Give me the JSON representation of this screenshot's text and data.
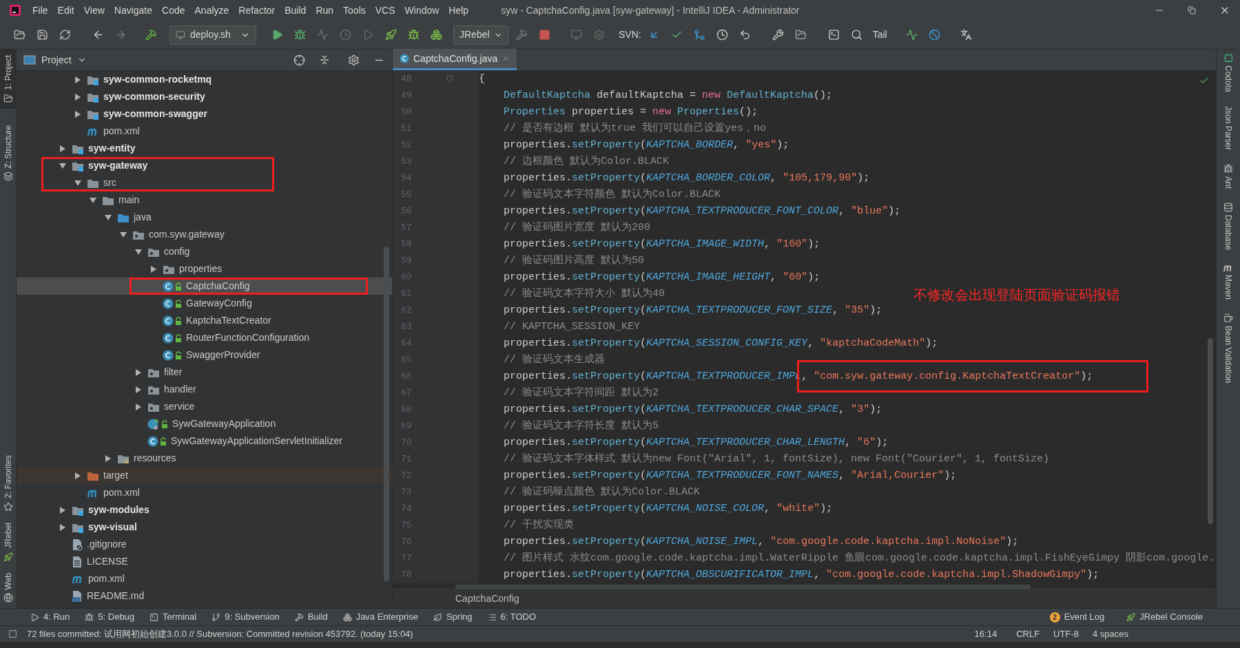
{
  "window": {
    "title": "syw - CaptchaConfig.java [syw-gateway] - IntelliJ IDEA - Administrator"
  },
  "menus": [
    "File",
    "Edit",
    "View",
    "Navigate",
    "Code",
    "Analyze",
    "Refactor",
    "Build",
    "Run",
    "Tools",
    "VCS",
    "Window",
    "Help"
  ],
  "toolbar": {
    "run_config": "deploy.sh",
    "jrebel": "JRebel",
    "svn_label": "SVN:",
    "tail": "Tail"
  },
  "left_tool_windows": [
    {
      "label": "1: Project",
      "kind": "project",
      "selected": true
    },
    {
      "label": "Z: Structure",
      "kind": "structure",
      "selected": false
    },
    {
      "label": "2: Favorites",
      "kind": "favorites",
      "selected": false
    },
    {
      "label": "JRebel",
      "kind": "jrebel",
      "selected": false
    },
    {
      "label": "Web",
      "kind": "web",
      "selected": false
    }
  ],
  "project": {
    "title": "Project",
    "tree": [
      {
        "children": [
          {
            "label": "syw-common-rocketmq",
            "kind": "module",
            "expanded": false,
            "selected": false
          },
          {
            "label": "syw-common-security",
            "kind": "module",
            "expanded": false,
            "selected": false
          },
          {
            "label": "syw-common-swagger",
            "kind": "module",
            "expanded": false,
            "selected": false
          },
          {
            "label": "pom.xml",
            "kind": "maven",
            "selected": false
          }
        ]
      },
      {
        "label": "syw-entity",
        "kind": "module",
        "expanded": false,
        "selected": false
      },
      {
        "label": "syw-gateway",
        "kind": "module",
        "expanded": true,
        "selected": false,
        "children": [
          {
            "label": "src",
            "kind": "folder",
            "expanded": true,
            "selected": false,
            "children": [
              {
                "label": "main",
                "kind": "folder",
                "expanded": true,
                "selected": false,
                "children": [
                  {
                    "label": "java",
                    "kind": "source-folder",
                    "expanded": true,
                    "selected": false,
                    "children": [
                      {
                        "label": "com.syw.gateway",
                        "kind": "package",
                        "expanded": true,
                        "selected": false,
                        "children": [
                          {
                            "label": "config",
                            "kind": "package",
                            "expanded": true,
                            "selected": false,
                            "children": [
                              {
                                "label": "properties",
                                "kind": "package",
                                "expanded": false,
                                "selected": false
                              },
                              {
                                "label": "CaptchaConfig",
                                "kind": "class",
                                "selected": true
                              },
                              {
                                "label": "GatewayConfig",
                                "kind": "class",
                                "selected": false
                              },
                              {
                                "label": "KaptchaTextCreator",
                                "kind": "class",
                                "selected": false
                              },
                              {
                                "label": "RouterFunctionConfiguration",
                                "kind": "class",
                                "selected": false
                              },
                              {
                                "label": "SwaggerProvider",
                                "kind": "class",
                                "selected": false
                              }
                            ]
                          },
                          {
                            "label": "filter",
                            "kind": "package",
                            "expanded": false,
                            "selected": false
                          },
                          {
                            "label": "handler",
                            "kind": "package",
                            "expanded": false,
                            "selected": false
                          },
                          {
                            "label": "service",
                            "kind": "package",
                            "expanded": false,
                            "selected": false
                          },
                          {
                            "label": "SywGatewayApplication",
                            "kind": "app-class",
                            "selected": false
                          },
                          {
                            "label": "SywGatewayApplicationServletInitializer",
                            "kind": "class",
                            "selected": false
                          }
                        ]
                      }
                    ]
                  },
                  {
                    "label": "resources",
                    "kind": "resources",
                    "expanded": false,
                    "selected": false
                  }
                ]
              }
            ]
          },
          {
            "label": "target",
            "kind": "excluded",
            "expanded": false,
            "selected": false
          },
          {
            "label": "pom.xml",
            "kind": "maven",
            "selected": false
          }
        ]
      },
      {
        "label": "syw-modules",
        "kind": "module",
        "expanded": false,
        "selected": false
      },
      {
        "label": "syw-visual",
        "kind": "module",
        "expanded": false,
        "selected": false
      },
      {
        "label": ".gitignore",
        "kind": "ignore-file",
        "selected": false
      },
      {
        "label": "LICENSE",
        "kind": "text-file",
        "selected": false
      },
      {
        "label": "pom.xml",
        "kind": "maven",
        "selected": false
      },
      {
        "label": "README.md",
        "kind": "markdown",
        "selected": false
      }
    ]
  },
  "editor": {
    "tab": {
      "label": "CaptchaConfig.java",
      "selected": true
    },
    "lines": [
      {
        "num": "48",
        "fold": true,
        "tokens": [
          {
            "kind": "plain",
            "text": "{"
          }
        ]
      },
      {
        "num": "49",
        "tokens": [
          {
            "kind": "type",
            "text": "    DefaultKaptcha"
          },
          {
            "kind": "plain",
            "text": " defaultKaptcha = "
          },
          {
            "kind": "keyword",
            "text": "new "
          },
          {
            "kind": "type",
            "text": "DefaultKaptcha"
          },
          {
            "kind": "plain",
            "text": "();"
          }
        ]
      },
      {
        "num": "50",
        "tokens": [
          {
            "kind": "type",
            "text": "    Properties"
          },
          {
            "kind": "plain",
            "text": " properties = "
          },
          {
            "kind": "keyword",
            "text": "new "
          },
          {
            "kind": "type",
            "text": "Properties"
          },
          {
            "kind": "plain",
            "text": "();"
          }
        ]
      },
      {
        "num": "51",
        "tokens": [
          {
            "kind": "comment",
            "text": "    // 是否有边框 默认为true 我们可以自己设置yes，no"
          }
        ]
      },
      {
        "num": "52",
        "tokens": [
          {
            "kind": "plain",
            "text": "    properties."
          },
          {
            "kind": "method",
            "text": "setProperty"
          },
          {
            "kind": "plain",
            "text": "("
          },
          {
            "kind": "constant",
            "text": "KAPTCHA_BORDER"
          },
          {
            "kind": "plain",
            "text": ", "
          },
          {
            "kind": "string",
            "text": "\"yes\""
          },
          {
            "kind": "plain",
            "text": ");"
          }
        ]
      },
      {
        "num": "53",
        "tokens": [
          {
            "kind": "comment",
            "text": "    // 边框颜色 默认为Color.BLACK"
          }
        ]
      },
      {
        "num": "54",
        "tokens": [
          {
            "kind": "plain",
            "text": "    properties."
          },
          {
            "kind": "method",
            "text": "setProperty"
          },
          {
            "kind": "plain",
            "text": "("
          },
          {
            "kind": "constant",
            "text": "KAPTCHA_BORDER_COLOR"
          },
          {
            "kind": "plain",
            "text": ", "
          },
          {
            "kind": "string",
            "text": "\"105,179,90\""
          },
          {
            "kind": "plain",
            "text": ");"
          }
        ]
      },
      {
        "num": "55",
        "tokens": [
          {
            "kind": "comment",
            "text": "    // 验证码文本字符颜色 默认为Color.BLACK"
          }
        ]
      },
      {
        "num": "56",
        "tokens": [
          {
            "kind": "plain",
            "text": "    properties."
          },
          {
            "kind": "method",
            "text": "setProperty"
          },
          {
            "kind": "plain",
            "text": "("
          },
          {
            "kind": "constant",
            "text": "KAPTCHA_TEXTPRODUCER_FONT_COLOR"
          },
          {
            "kind": "plain",
            "text": ", "
          },
          {
            "kind": "string",
            "text": "\"blue\""
          },
          {
            "kind": "plain",
            "text": ");"
          }
        ]
      },
      {
        "num": "57",
        "tokens": [
          {
            "kind": "comment",
            "text": "    // 验证码图片宽度 默认为200"
          }
        ]
      },
      {
        "num": "58",
        "tokens": [
          {
            "kind": "plain",
            "text": "    properties."
          },
          {
            "kind": "method",
            "text": "setProperty"
          },
          {
            "kind": "plain",
            "text": "("
          },
          {
            "kind": "constant",
            "text": "KAPTCHA_IMAGE_WIDTH"
          },
          {
            "kind": "plain",
            "text": ", "
          },
          {
            "kind": "string",
            "text": "\"160\""
          },
          {
            "kind": "plain",
            "text": ");"
          }
        ]
      },
      {
        "num": "59",
        "tokens": [
          {
            "kind": "comment",
            "text": "    // 验证码图片高度 默认为50"
          }
        ]
      },
      {
        "num": "60",
        "tokens": [
          {
            "kind": "plain",
            "text": "    properties."
          },
          {
            "kind": "method",
            "text": "setProperty"
          },
          {
            "kind": "plain",
            "text": "("
          },
          {
            "kind": "constant",
            "text": "KAPTCHA_IMAGE_HEIGHT"
          },
          {
            "kind": "plain",
            "text": ", "
          },
          {
            "kind": "string",
            "text": "\"60\""
          },
          {
            "kind": "plain",
            "text": ");"
          }
        ]
      },
      {
        "num": "61",
        "tokens": [
          {
            "kind": "comment",
            "text": "    // 验证码文本字符大小 默认为40"
          }
        ]
      },
      {
        "num": "62",
        "tokens": [
          {
            "kind": "plain",
            "text": "    properties."
          },
          {
            "kind": "method",
            "text": "setProperty"
          },
          {
            "kind": "plain",
            "text": "("
          },
          {
            "kind": "constant",
            "text": "KAPTCHA_TEXTPRODUCER_FONT_SIZE"
          },
          {
            "kind": "plain",
            "text": ", "
          },
          {
            "kind": "string",
            "text": "\"35\""
          },
          {
            "kind": "plain",
            "text": ");"
          }
        ]
      },
      {
        "num": "63",
        "tokens": [
          {
            "kind": "comment",
            "text": "    // KAPTCHA_SESSION_KEY"
          }
        ]
      },
      {
        "num": "64",
        "tokens": [
          {
            "kind": "plain",
            "text": "    properties."
          },
          {
            "kind": "method",
            "text": "setProperty"
          },
          {
            "kind": "plain",
            "text": "("
          },
          {
            "kind": "constant",
            "text": "KAPTCHA_SESSION_CONFIG_KEY"
          },
          {
            "kind": "plain",
            "text": ", "
          },
          {
            "kind": "string",
            "text": "\"kaptchaCodeMath\""
          },
          {
            "kind": "plain",
            "text": ");"
          }
        ]
      },
      {
        "num": "65",
        "tokens": [
          {
            "kind": "comment",
            "text": "    // 验证码文本生成器"
          }
        ]
      },
      {
        "num": "66",
        "tokens": [
          {
            "kind": "plain",
            "text": "    properties."
          },
          {
            "kind": "method",
            "text": "setProperty"
          },
          {
            "kind": "plain",
            "text": "("
          },
          {
            "kind": "constant",
            "text": "KAPTCHA_TEXTPRODUCER_IMPL"
          },
          {
            "kind": "plain",
            "text": ", "
          },
          {
            "kind": "string",
            "text": "\"com.syw.gateway.config.KaptchaTextCreator\""
          },
          {
            "kind": "plain",
            "text": ");"
          }
        ]
      },
      {
        "num": "67",
        "tokens": [
          {
            "kind": "comment",
            "text": "    // 验证码文本字符间距 默认为2"
          }
        ]
      },
      {
        "num": "68",
        "tokens": [
          {
            "kind": "plain",
            "text": "    properties."
          },
          {
            "kind": "method",
            "text": "setProperty"
          },
          {
            "kind": "plain",
            "text": "("
          },
          {
            "kind": "constant",
            "text": "KAPTCHA_TEXTPRODUCER_CHAR_SPACE"
          },
          {
            "kind": "plain",
            "text": ", "
          },
          {
            "kind": "string",
            "text": "\"3\""
          },
          {
            "kind": "plain",
            "text": ");"
          }
        ]
      },
      {
        "num": "69",
        "tokens": [
          {
            "kind": "comment",
            "text": "    // 验证码文本字符长度 默认为5"
          }
        ]
      },
      {
        "num": "70",
        "tokens": [
          {
            "kind": "plain",
            "text": "    properties."
          },
          {
            "kind": "method",
            "text": "setProperty"
          },
          {
            "kind": "plain",
            "text": "("
          },
          {
            "kind": "constant",
            "text": "KAPTCHA_TEXTPRODUCER_CHAR_LENGTH"
          },
          {
            "kind": "plain",
            "text": ", "
          },
          {
            "kind": "string",
            "text": "\"6\""
          },
          {
            "kind": "plain",
            "text": ");"
          }
        ]
      },
      {
        "num": "71",
        "tokens": [
          {
            "kind": "comment",
            "text": "    // 验证码文本字体样式 默认为new Font(\"Arial\", 1, fontSize), new Font(\"Courier\", 1, fontSize)"
          }
        ]
      },
      {
        "num": "72",
        "tokens": [
          {
            "kind": "plain",
            "text": "    properties."
          },
          {
            "kind": "method",
            "text": "setProperty"
          },
          {
            "kind": "plain",
            "text": "("
          },
          {
            "kind": "constant",
            "text": "KAPTCHA_TEXTPRODUCER_FONT_NAMES"
          },
          {
            "kind": "plain",
            "text": ", "
          },
          {
            "kind": "string",
            "text": "\"Arial,Courier\""
          },
          {
            "kind": "plain",
            "text": ");"
          }
        ]
      },
      {
        "num": "73",
        "tokens": [
          {
            "kind": "comment",
            "text": "    // 验证码噪点颜色 默认为Color.BLACK"
          }
        ]
      },
      {
        "num": "74",
        "tokens": [
          {
            "kind": "plain",
            "text": "    properties."
          },
          {
            "kind": "method",
            "text": "setProperty"
          },
          {
            "kind": "plain",
            "text": "("
          },
          {
            "kind": "constant",
            "text": "KAPTCHA_NOISE_COLOR"
          },
          {
            "kind": "plain",
            "text": ", "
          },
          {
            "kind": "string",
            "text": "\"white\""
          },
          {
            "kind": "plain",
            "text": ");"
          }
        ]
      },
      {
        "num": "75",
        "tokens": [
          {
            "kind": "comment",
            "text": "    // 干扰实现类"
          }
        ]
      },
      {
        "num": "76",
        "tokens": [
          {
            "kind": "plain",
            "text": "    properties."
          },
          {
            "kind": "method",
            "text": "setProperty"
          },
          {
            "kind": "plain",
            "text": "("
          },
          {
            "kind": "constant",
            "text": "KAPTCHA_NOISE_IMPL"
          },
          {
            "kind": "plain",
            "text": ", "
          },
          {
            "kind": "string",
            "text": "\"com.google.code.kaptcha.impl.NoNoise\""
          },
          {
            "kind": "plain",
            "text": ");"
          }
        ]
      },
      {
        "num": "77",
        "tokens": [
          {
            "kind": "comment",
            "text": "    // 图片样式 水纹com.google.code.kaptcha.impl.WaterRipple 鱼眼com.google.code.kaptcha.impl.FishEyeGimpy 阴影com.google."
          }
        ]
      },
      {
        "num": "78",
        "tokens": [
          {
            "kind": "plain",
            "text": "    properties."
          },
          {
            "kind": "method",
            "text": "setProperty"
          },
          {
            "kind": "plain",
            "text": "("
          },
          {
            "kind": "constant",
            "text": "KAPTCHA_OBSCURIFICATOR_IMPL"
          },
          {
            "kind": "plain",
            "text": ", "
          },
          {
            "kind": "string",
            "text": "\"com.google.code.kaptcha.impl.ShadowGimpy\""
          },
          {
            "kind": "plain",
            "text": ");"
          }
        ]
      }
    ],
    "breadcrumb": "CaptchaConfig",
    "note": "不修改会出现登陆页面验证码报错"
  },
  "right_tool_windows": [
    {
      "label": "Codota",
      "kind": "codota"
    },
    {
      "label": "Json Parser",
      "kind": "json"
    },
    {
      "label": "Ant",
      "kind": "ant"
    },
    {
      "label": "Database",
      "kind": "database"
    },
    {
      "label": "Maven",
      "kind": "maven"
    },
    {
      "label": "Bean Validation",
      "kind": "bean"
    }
  ],
  "bottom_tools": [
    {
      "label": "4: Run",
      "kind": "run"
    },
    {
      "label": "5: Debug",
      "kind": "debug"
    },
    {
      "label": "Terminal",
      "kind": "terminal"
    },
    {
      "label": "9: Subversion",
      "kind": "vcs"
    },
    {
      "label": "Build",
      "kind": "build"
    },
    {
      "label": "Java Enterprise",
      "kind": "enterprise"
    },
    {
      "label": "Spring",
      "kind": "spring"
    },
    {
      "label": "6: TODO",
      "kind": "todo"
    }
  ],
  "bottom_tools_right": [
    {
      "label": "Event Log",
      "kind": "event-log",
      "badge": "2"
    },
    {
      "label": "JRebel Console",
      "kind": "jrebel"
    }
  ],
  "status_bar": {
    "message": "72 files committed: 试用网初始创建3.0.0 // Subversion: Committed revision 453792. (today 15:04)",
    "position": "16:14",
    "line_separator": "CRLF",
    "encoding": "UTF-8",
    "indent": "4 spaces"
  }
}
